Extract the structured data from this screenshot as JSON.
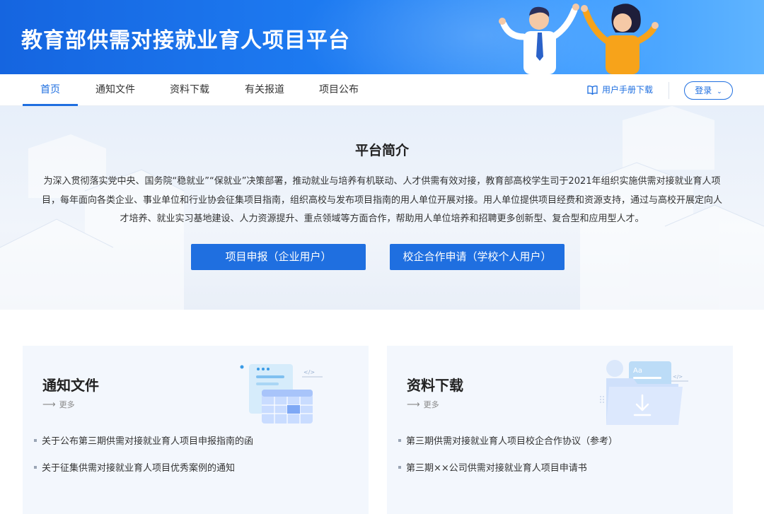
{
  "header": {
    "title": "教育部供需对接就业育人项目平台"
  },
  "nav": {
    "tabs": [
      {
        "label": "首页",
        "active": true
      },
      {
        "label": "通知文件",
        "active": false
      },
      {
        "label": "资料下载",
        "active": false
      },
      {
        "label": "有关报道",
        "active": false
      },
      {
        "label": "项目公布",
        "active": false
      }
    ],
    "manual_label": "用户手册下载",
    "login_label": "登录"
  },
  "hero": {
    "title": "平台简介",
    "text": "为深入贯彻落实党中央、国务院“稳就业”“保就业”决策部署，推动就业与培养有机联动、人才供需有效对接，教育部高校学生司于2021年组织实施供需对接就业育人项目，每年面向各类企业、事业单位和行业协会征集项目指南，组织高校与发布项目指南的用人单位开展对接。用人单位提供项目经费和资源支持，通过与高校开展定向人才培养、就业实习基地建设、人力资源提升、重点领域等方面合作，帮助用人单位培养和招聘更多创新型、复合型和应用型人才。",
    "buttons": [
      "项目申报（企业用户）",
      "校企合作申请（学校个人用户）"
    ]
  },
  "cards": [
    {
      "title": "通知文件",
      "more": "更多",
      "items": [
        "关于公布第三期供需对接就业育人项目申报指南的函",
        "关于征集供需对接就业育人项目优秀案例的通知"
      ]
    },
    {
      "title": "资料下载",
      "more": "更多",
      "items": [
        "第三期供需对接就业育人项目校企合作协议（参考）",
        "第三期××公司供需对接就业育人项目申请书"
      ]
    }
  ],
  "colors": {
    "accent": "#1f6fe0",
    "banner": "#1e7cf2",
    "card_bg": "#f3f7fd"
  }
}
